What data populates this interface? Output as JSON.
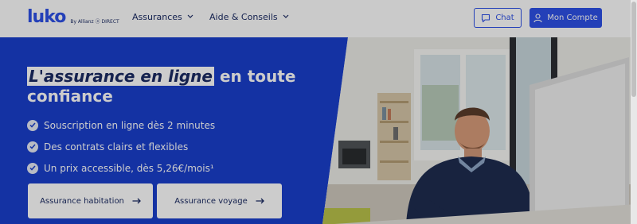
{
  "header": {
    "logo_text": "luko",
    "logo_byline": "By Allianz ⓐ DIRECT",
    "nav": [
      {
        "label": "Assurances"
      },
      {
        "label": "Aide & Conseils"
      }
    ],
    "chat_label": "Chat",
    "account_label": "Mon Compte"
  },
  "hero": {
    "title_highlight": "L'assurance en ligne",
    "title_rest": " en toute confiance",
    "benefits": [
      "Souscription en ligne dès 2 minutes",
      "Des contrats clairs et flexibles",
      "Un prix accessible, dès 5,26€/mois¹"
    ],
    "cta": [
      {
        "label": "Assurance habitation"
      },
      {
        "label": "Assurance voyage"
      }
    ]
  },
  "colors": {
    "brand_blue": "#2d50e6",
    "hero_blue": "#1a3fcc",
    "navy_text": "#1b2b63"
  },
  "icons": [
    "chat-bubble-icon",
    "user-icon",
    "chevron-down-icon",
    "check-circle-icon",
    "arrow-right-icon"
  ]
}
